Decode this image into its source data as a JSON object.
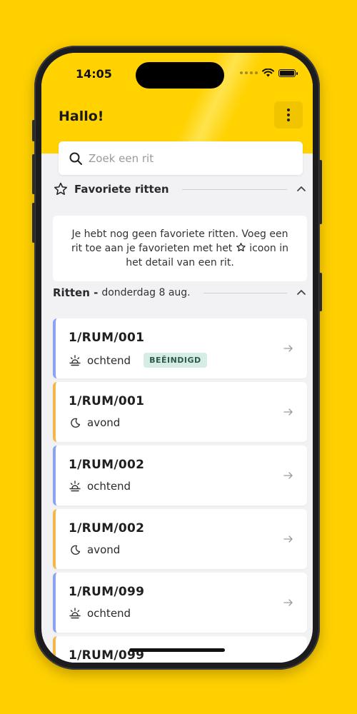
{
  "status_bar": {
    "time": "14:05"
  },
  "header": {
    "greeting": "Hallo!"
  },
  "search": {
    "placeholder": "Zoek een rit",
    "value": ""
  },
  "favorites": {
    "title": "Favoriete ritten",
    "empty_text_before": "Je hebt nog geen favoriete ritten. Voeg een rit toe aan je favorieten met het",
    "empty_icon": "star-icon",
    "empty_text_after": "icoon in het detail van een rit."
  },
  "rides_section": {
    "title": "Ritten -",
    "date": "donderdag 8 aug."
  },
  "rides": [
    {
      "code": "1/RUM/001",
      "period": "ochtend",
      "icon": "sunrise-icon",
      "badge": "BEËINDIGD"
    },
    {
      "code": "1/RUM/001",
      "period": "avond",
      "icon": "moon-icon",
      "badge": ""
    },
    {
      "code": "1/RUM/002",
      "period": "ochtend",
      "icon": "sunrise-icon",
      "badge": ""
    },
    {
      "code": "1/RUM/002",
      "period": "avond",
      "icon": "moon-icon",
      "badge": ""
    },
    {
      "code": "1/RUM/099",
      "period": "ochtend",
      "icon": "sunrise-icon",
      "badge": ""
    },
    {
      "code": "1/RUM/099",
      "period": "",
      "icon": "",
      "badge": ""
    }
  ],
  "colors": {
    "brand_yellow": "#FFD200",
    "morning_accent": "#8AA4F0",
    "evening_accent": "#F2B84B",
    "badge_bg": "#D6EDE6"
  }
}
